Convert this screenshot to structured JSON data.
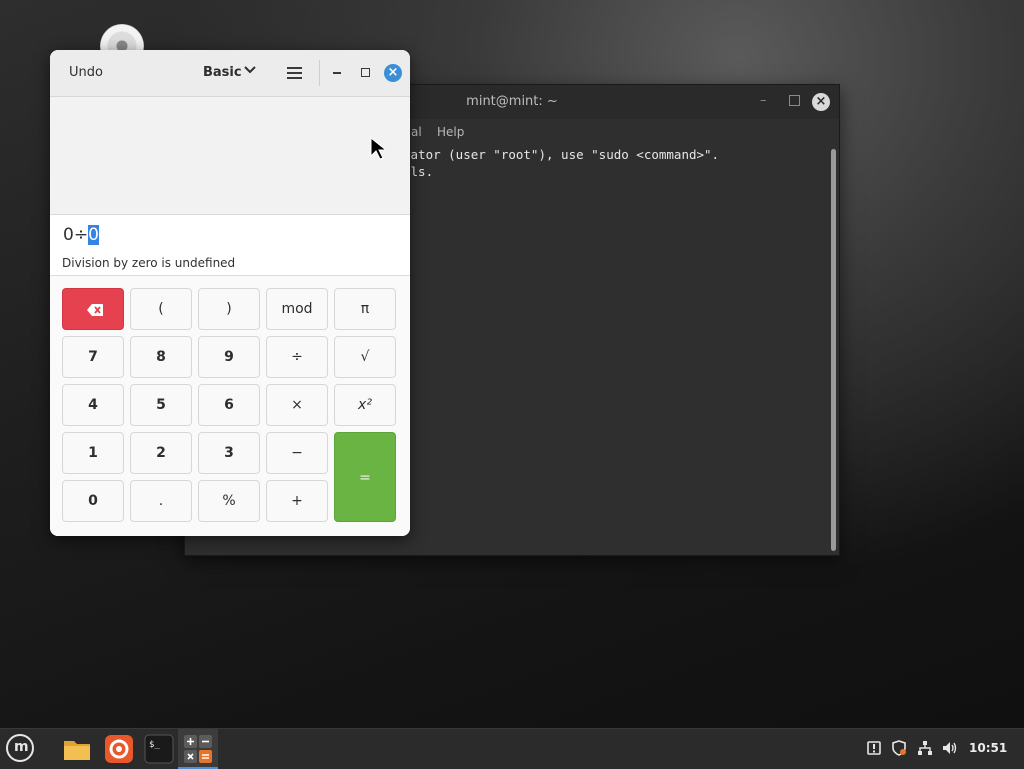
{
  "terminal": {
    "title": "mint@mint: ~",
    "menu_partial": "al",
    "menu_help": "Help",
    "lines": [
      "rator (user \"root\"), use \"sudo <command>\".",
      "ils."
    ]
  },
  "calculator": {
    "undo_label": "Undo",
    "mode_label": "Basic",
    "expression_before": "0÷",
    "expression_selected": "0",
    "error_message": "Division by zero is undefined",
    "keys": {
      "backspace": "",
      "lparen": "(",
      "rparen": ")",
      "mod": "mod",
      "pi": "π",
      "k7": "7",
      "k8": "8",
      "k9": "9",
      "divide": "÷",
      "sqrt": "√",
      "k4": "4",
      "k5": "5",
      "k6": "6",
      "multiply": "×",
      "square": "x²",
      "k1": "1",
      "k2": "2",
      "k3": "3",
      "minus": "−",
      "equals": "=",
      "k0": "0",
      "dot": ".",
      "percent": "%",
      "plus": "+"
    }
  },
  "taskbar": {
    "clock": "10:51"
  },
  "icons": {
    "menu": "linux-mint-menu-icon",
    "files": "folder-icon",
    "browser": "firefox-icon",
    "terminal": "terminal-icon",
    "calculator": "calculator-icon",
    "tray": [
      "update-manager-icon",
      "shield-icon",
      "network-icon",
      "volume-icon"
    ]
  },
  "colors": {
    "accent": "#3584e4",
    "backspace_key": "#e5414f",
    "equals_key": "#6ab443",
    "close_button": "#3a8fd6"
  }
}
